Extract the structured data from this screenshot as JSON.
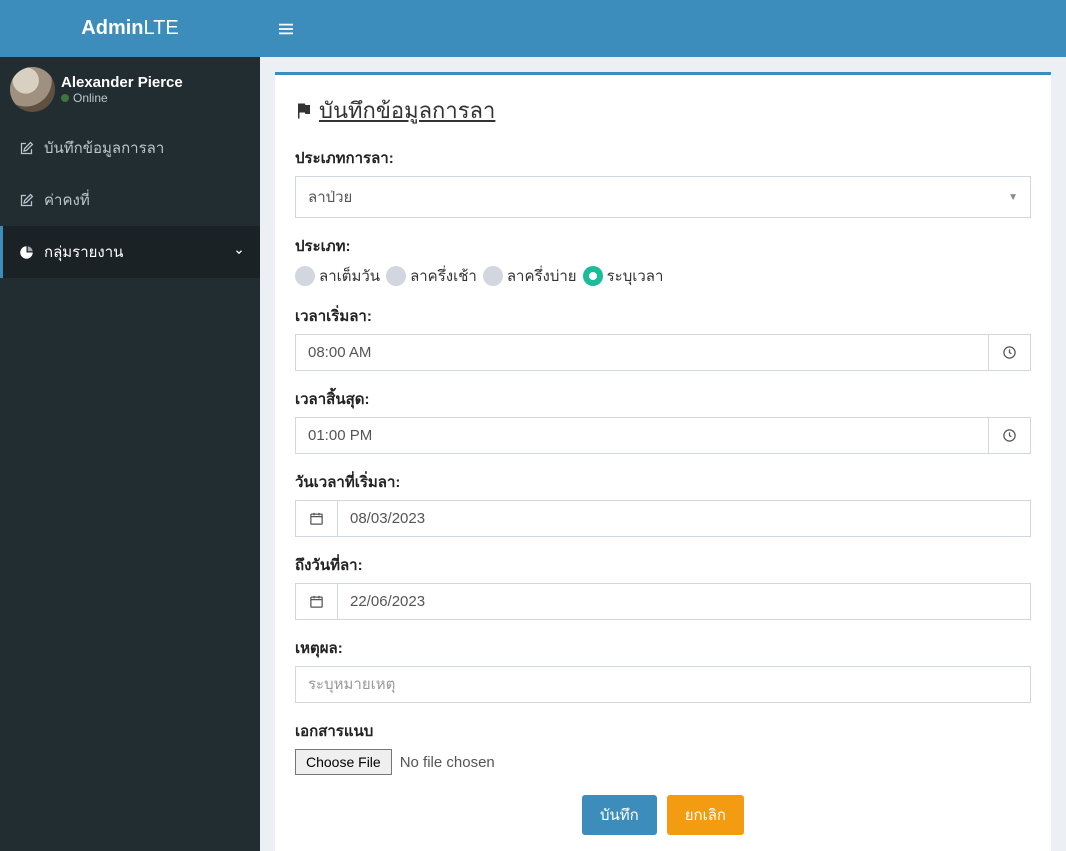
{
  "brand": {
    "bold": "Admin",
    "light": "LTE"
  },
  "user": {
    "name": "Alexander Pierce",
    "status": "Online"
  },
  "sidebar": {
    "items": [
      {
        "label": "บันทึกข้อมูลการลา"
      },
      {
        "label": "ค่าคงที่"
      },
      {
        "label": "กลุ่มรายงาน"
      }
    ]
  },
  "page": {
    "title": " บันทึกข้อมูลการลา",
    "labels": {
      "leave_type": "ประเภทการลา:",
      "type": "ประเภท:",
      "start_time": "เวลาเริ่มลา:",
      "end_time": "เวลาสิ้นสุด:",
      "start_date": "วันเวลาที่เริ่มลา:",
      "end_date": "ถึงวันที่ลา:",
      "reason": "เหตุผล:",
      "attachment": "เอกสารแนบ"
    },
    "leave_type_value": "ลาป่วย",
    "radios": [
      {
        "label": "ลาเต็มวัน",
        "checked": false
      },
      {
        "label": "ลาครึ่งเช้า",
        "checked": false
      },
      {
        "label": "ลาครึ่งบ่าย",
        "checked": false
      },
      {
        "label": "ระบุเวลา",
        "checked": true
      }
    ],
    "start_time_value": "08:00 AM",
    "end_time_value": "01:00 PM",
    "start_date_value": "08/03/2023",
    "end_date_value": "22/06/2023",
    "reason_placeholder": "ระบุหมายเหตุ",
    "file_button": "Choose File",
    "file_status": "No file chosen",
    "save_label": "บันทึก",
    "cancel_label": "ยกเลิก"
  }
}
